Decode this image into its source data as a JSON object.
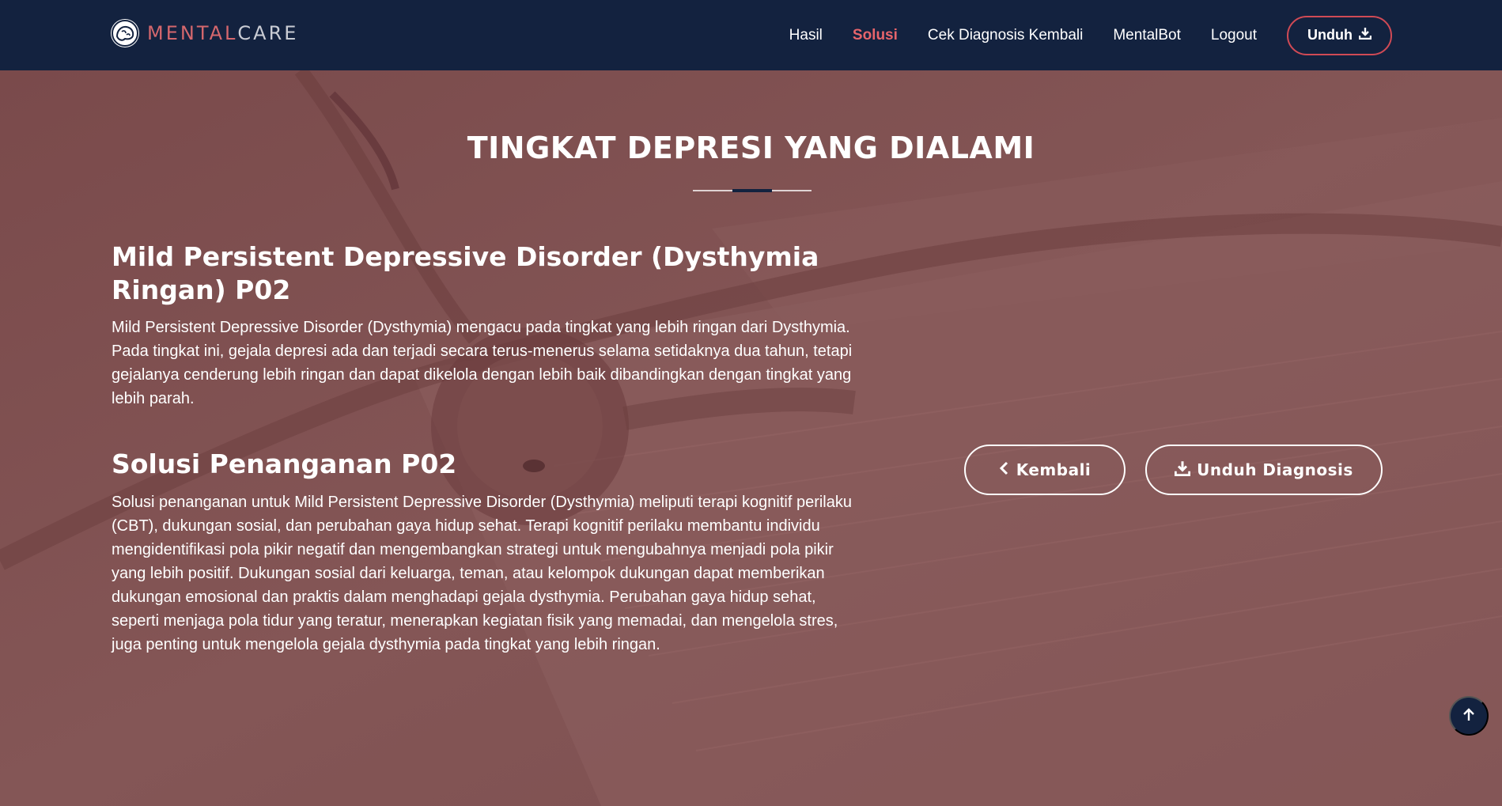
{
  "brand": {
    "part1": "MENTAL",
    "part2": "CARE",
    "colors": {
      "accent": "#d4676d",
      "muted": "#c9ccd4"
    }
  },
  "nav": {
    "items": [
      {
        "label": "Hasil",
        "active": false
      },
      {
        "label": "Solusi",
        "active": true
      },
      {
        "label": "Cek Diagnosis Kembali",
        "active": false
      },
      {
        "label": "MentalBot",
        "active": false
      },
      {
        "label": "Logout",
        "active": false
      }
    ],
    "download_label": "Unduh",
    "download_icon": "download-icon"
  },
  "main": {
    "section_title": "TINGKAT DEPRESI YANG DIALAMI",
    "diagnosis_title": "Mild Persistent Depressive Disorder (Dysthymia Ringan) P02",
    "diagnosis_desc": "Mild Persistent Depressive Disorder (Dysthymia) mengacu pada tingkat yang lebih ringan dari Dysthymia. Pada tingkat ini, gejala depresi ada dan terjadi secara terus-menerus selama setidaknya dua tahun, tetapi gejalanya cenderung lebih ringan dan dapat dikelola dengan lebih baik dibandingkan dengan tingkat yang lebih parah.",
    "solution_title": "Solusi Penanganan P02",
    "solution_desc": "Solusi penanganan untuk Mild Persistent Depressive Disorder (Dysthymia) meliputi terapi kognitif perilaku (CBT), dukungan sosial, dan perubahan gaya hidup sehat. Terapi kognitif perilaku membantu individu mengidentifikasi pola pikir negatif dan mengembangkan strategi untuk mengubahnya menjadi pola pikir yang lebih positif. Dukungan sosial dari keluarga, teman, atau kelompok dukungan dapat memberikan dukungan emosional dan praktis dalam menghadapi gejala dysthymia. Perubahan gaya hidup sehat, seperti menjaga pola tidur yang teratur, menerapkan kegiatan fisik yang memadai, dan mengelola stres, juga penting untuk mengelola gejala dysthymia pada tingkat yang lebih ringan.",
    "back_label": "Kembali",
    "download_diag_label": "Unduh Diagnosis"
  },
  "colors": {
    "navbar": "#13223f",
    "background": "#7d4f4f",
    "active_link": "#e7646b",
    "outline_red": "#d04a55"
  }
}
